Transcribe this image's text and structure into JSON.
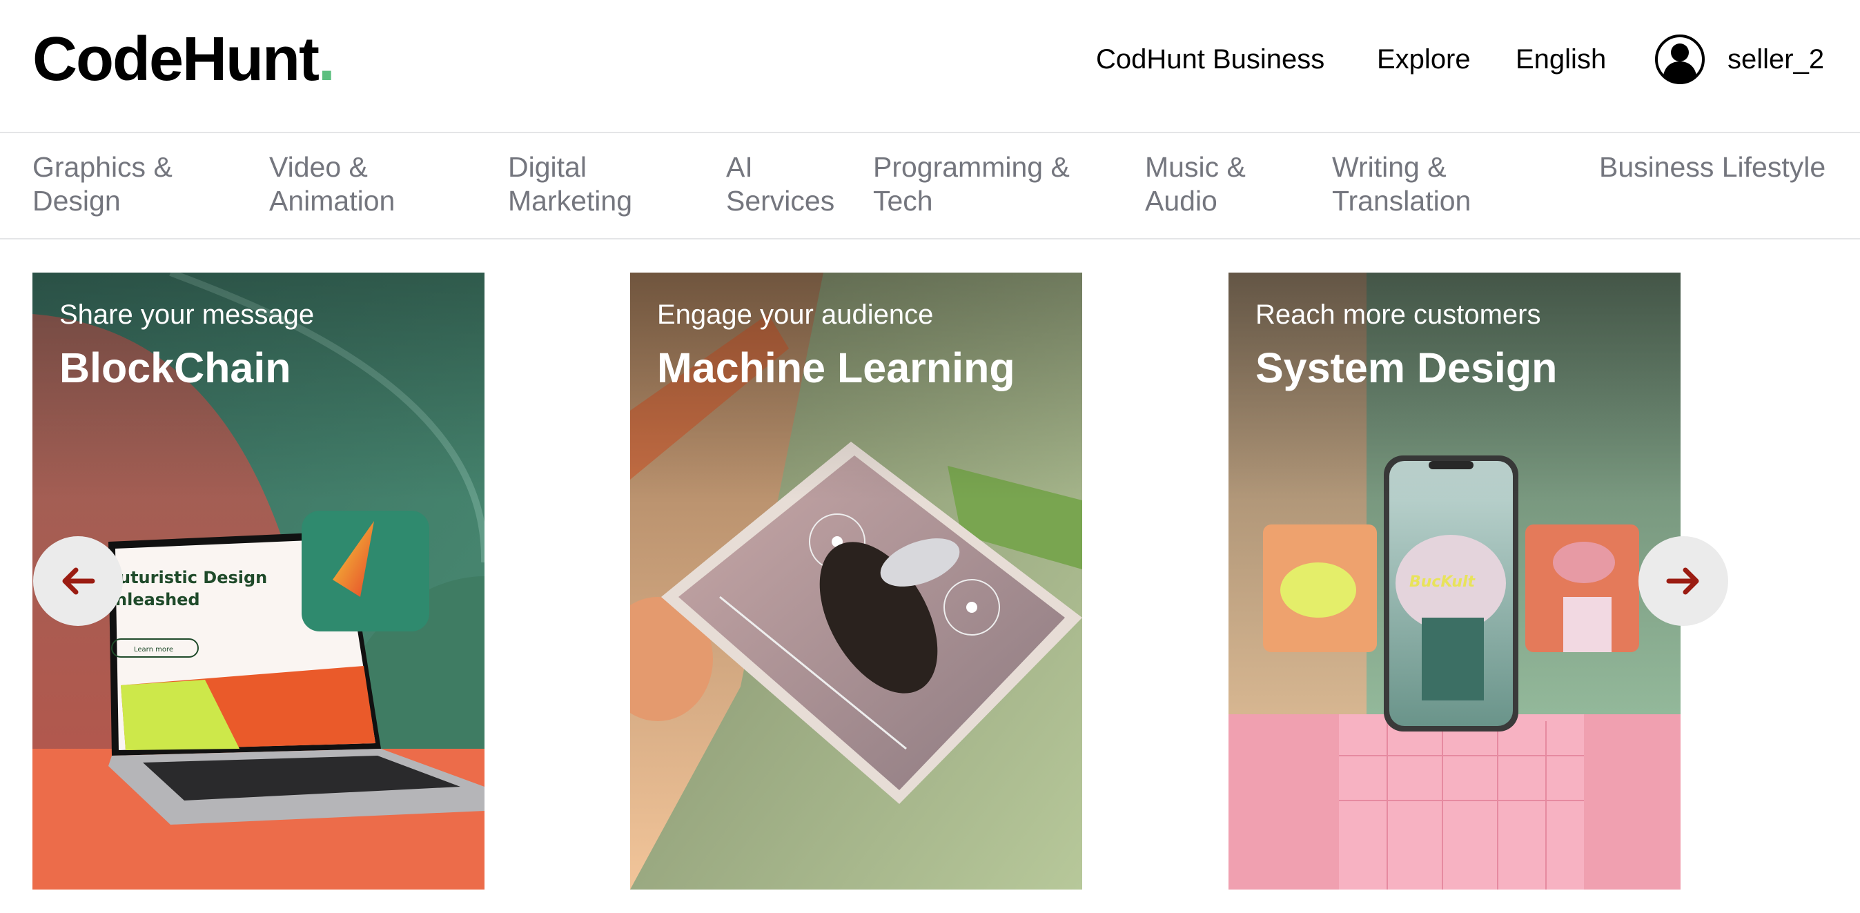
{
  "header": {
    "logo_text": "CodeHunt",
    "logo_dot": ".",
    "nav": {
      "business": "CodHunt Business",
      "explore": "Explore",
      "language": "English"
    },
    "user": {
      "avatar_icon": "user-circle-icon",
      "username": "seller_2"
    }
  },
  "colors": {
    "brand_accent": "#5cbf7f",
    "category_text": "#74767e",
    "arrow": "#9b1c12",
    "arrow_button_bg": "#ebebeb"
  },
  "categories": [
    {
      "line1": "Graphics &",
      "line2": "Design"
    },
    {
      "line1": "Video &",
      "line2": "Animation"
    },
    {
      "line1": "Digital",
      "line2": "Marketing"
    },
    {
      "line1": "AI",
      "line2": "Services"
    },
    {
      "line1": "Programming &",
      "line2": "Tech"
    },
    {
      "line1": "Music &",
      "line2": "Audio"
    },
    {
      "line1": "Writing &",
      "line2": "Translation"
    },
    {
      "line1": "Business Lifestyle",
      "line2": ""
    }
  ],
  "carousel": {
    "prev_icon": "arrow-left-icon",
    "next_icon": "arrow-right-icon",
    "cards": [
      {
        "subtitle": "Share your message",
        "title": "BlockChain",
        "image_text_1": "uturistic Design",
        "image_text_2": "nleashed",
        "image_button": "Learn more"
      },
      {
        "subtitle": "Engage your audience",
        "title": "Machine Learning"
      },
      {
        "subtitle": "Reach more customers",
        "title": "System Design",
        "image_brand": "BucKult"
      }
    ]
  }
}
